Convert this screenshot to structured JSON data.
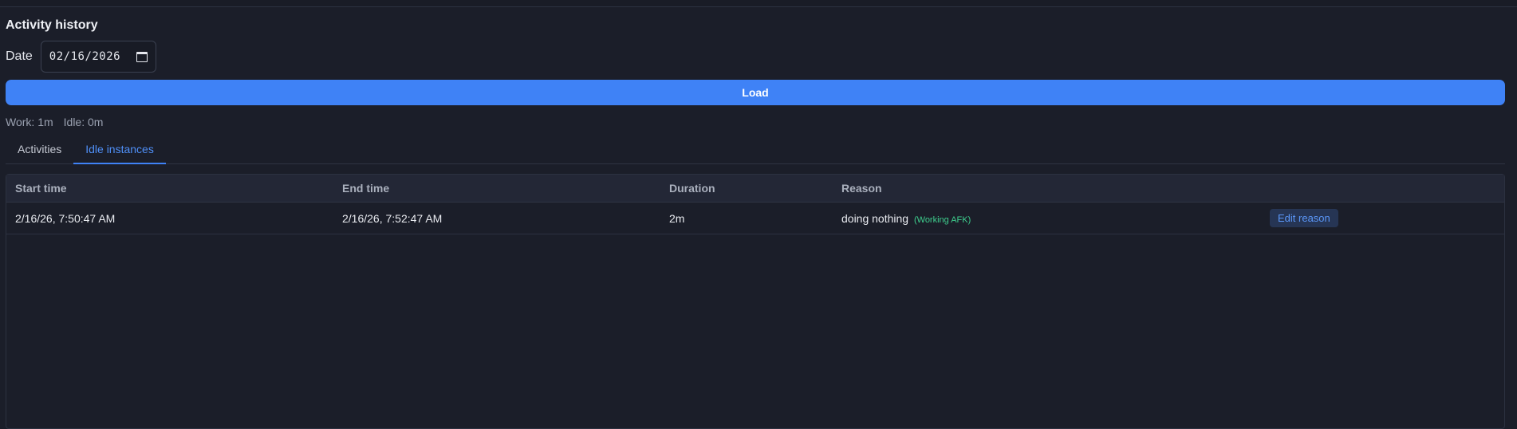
{
  "page": {
    "title": "Activity history"
  },
  "date_filter": {
    "label": "Date",
    "value": "02/16/2026"
  },
  "load_button": {
    "label": "Load"
  },
  "summary": {
    "work": "Work: 1m",
    "idle": "Idle: 0m"
  },
  "tabs": [
    {
      "label": "Activities",
      "active": false
    },
    {
      "label": "Idle instances",
      "active": true
    }
  ],
  "table": {
    "headers": [
      "Start time",
      "End time",
      "Duration",
      "Reason"
    ],
    "rows": [
      {
        "start": "2/16/26, 7:50:47 AM",
        "end": "2/16/26, 7:52:47 AM",
        "duration": "2m",
        "reason": "doing nothing",
        "tag": "(Working AFK)",
        "action": "Edit reason"
      }
    ]
  },
  "colors": {
    "accent": "#3f82f6",
    "tag": "#3ecf8e",
    "background": "#1b1e29"
  },
  "icons": {
    "date_picker": "calendar-icon"
  }
}
